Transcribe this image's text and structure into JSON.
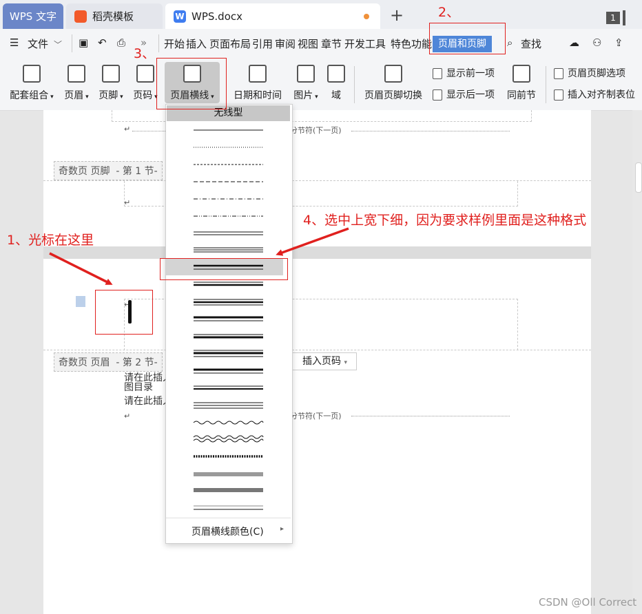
{
  "tabs": {
    "wps": "WPS 文字",
    "daoke": "稻壳模板",
    "doc": "WPS.docx",
    "plus": "+",
    "window_count": "1"
  },
  "menu": {
    "file": "文件",
    "items": [
      "开始",
      "插入",
      "页面布局",
      "引用",
      "审阅",
      "视图",
      "章节",
      "开发工具",
      "特色功能"
    ],
    "active_tab": "页眉和页脚",
    "search": "查找"
  },
  "ribbon": {
    "kit": "配套组合",
    "header": "页眉",
    "footer": "页脚",
    "page_number": "页码",
    "header_line": "页眉横线",
    "date_time": "日期和时间",
    "picture": "图片",
    "field": "域",
    "switch": "页眉页脚切换",
    "prev": "显示前一项",
    "next": "显示后一项",
    "same_as_prev": "同前节",
    "options": "页眉页脚选项",
    "insert_align_tab": "插入对齐制表位"
  },
  "dropdown": {
    "none": "无线型",
    "color": "页眉横线颜色(C)"
  },
  "document": {
    "p1_section_break": "分节符(下一页)",
    "p1_footer_label": "奇数页 页脚",
    "p1_footer_section": "- 第 1 节-",
    "p2_header_label": "奇数页 页眉",
    "p2_header_section": "- 第 2 节-",
    "insert_page_number": "插入页码",
    "line_a": "请在此插入",
    "line_b": "图目录",
    "line_c": "请在此插入",
    "p2_section_break": "分节符(下一页)"
  },
  "annotations": {
    "step1": "1、光标在这里",
    "step2": "2、",
    "step3": "3、",
    "step4": "4、选中上宽下细，因为要求样例里面是这种格式"
  },
  "watermark": "CSDN @Oll Correct",
  "colors": {
    "annotation_red": "#e0201e",
    "active_tab_blue": "#4e86d8",
    "wps_tab": "#6b86c8"
  }
}
